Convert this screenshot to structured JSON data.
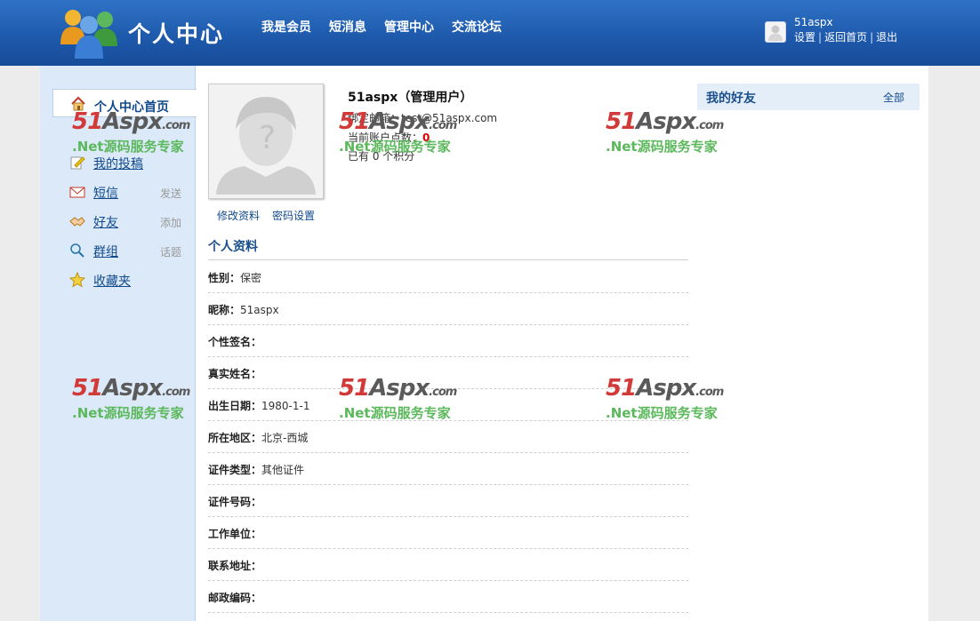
{
  "header": {
    "title": "个人中心",
    "nav": [
      "我是会员",
      "短消息",
      "管理中心",
      "交流论坛"
    ],
    "user_name": "51aspx",
    "links": [
      "设置",
      "返回首页",
      "退出"
    ]
  },
  "sidebar": {
    "home_label": "个人中心首页",
    "items": [
      {
        "label": "我的投稿",
        "action": ""
      },
      {
        "label": "短信",
        "action": "发送"
      },
      {
        "label": "好友",
        "action": "添加"
      },
      {
        "label": "群组",
        "action": "话题"
      },
      {
        "label": "收藏夹",
        "action": ""
      }
    ]
  },
  "profile": {
    "name": "51aspx（管理用户）",
    "email_label": "绑定邮箱：",
    "email": "test@51aspx.com",
    "points_label": "当前账户点数：",
    "points": "0",
    "score_text": "已有 0 个积分",
    "edit_link": "修改资料",
    "password_link": "密码设置"
  },
  "info": {
    "title": "个人资料",
    "rows": [
      {
        "key": "性别：",
        "value": "保密"
      },
      {
        "key": "昵称：",
        "value": "51aspx"
      },
      {
        "key": "个性签名：",
        "value": ""
      },
      {
        "key": "真实姓名：",
        "value": ""
      },
      {
        "key": "出生日期：",
        "value": "1980-1-1"
      },
      {
        "key": "所在地区：",
        "value": "北京-西城"
      },
      {
        "key": "证件类型：",
        "value": "其他证件"
      },
      {
        "key": "证件号码：",
        "value": ""
      },
      {
        "key": "工作单位：",
        "value": ""
      },
      {
        "key": "联系地址：",
        "value": ""
      },
      {
        "key": "邮政编码：",
        "value": ""
      }
    ]
  },
  "friends": {
    "title": "我的好友",
    "all_link": "全部"
  },
  "watermark": {
    "brand_red": "51",
    "brand_grey": "Aspx",
    "brand_com": ".com",
    "slogan": ".Net源码服务专家"
  },
  "colors": {
    "header_blue": "#1d58aa",
    "sidebar_bg": "#dbe9f8",
    "link_blue": "#114a8c",
    "points_red": "#dd0000",
    "watermark_red": "#d23a3a",
    "watermark_green": "#5cb85c"
  }
}
